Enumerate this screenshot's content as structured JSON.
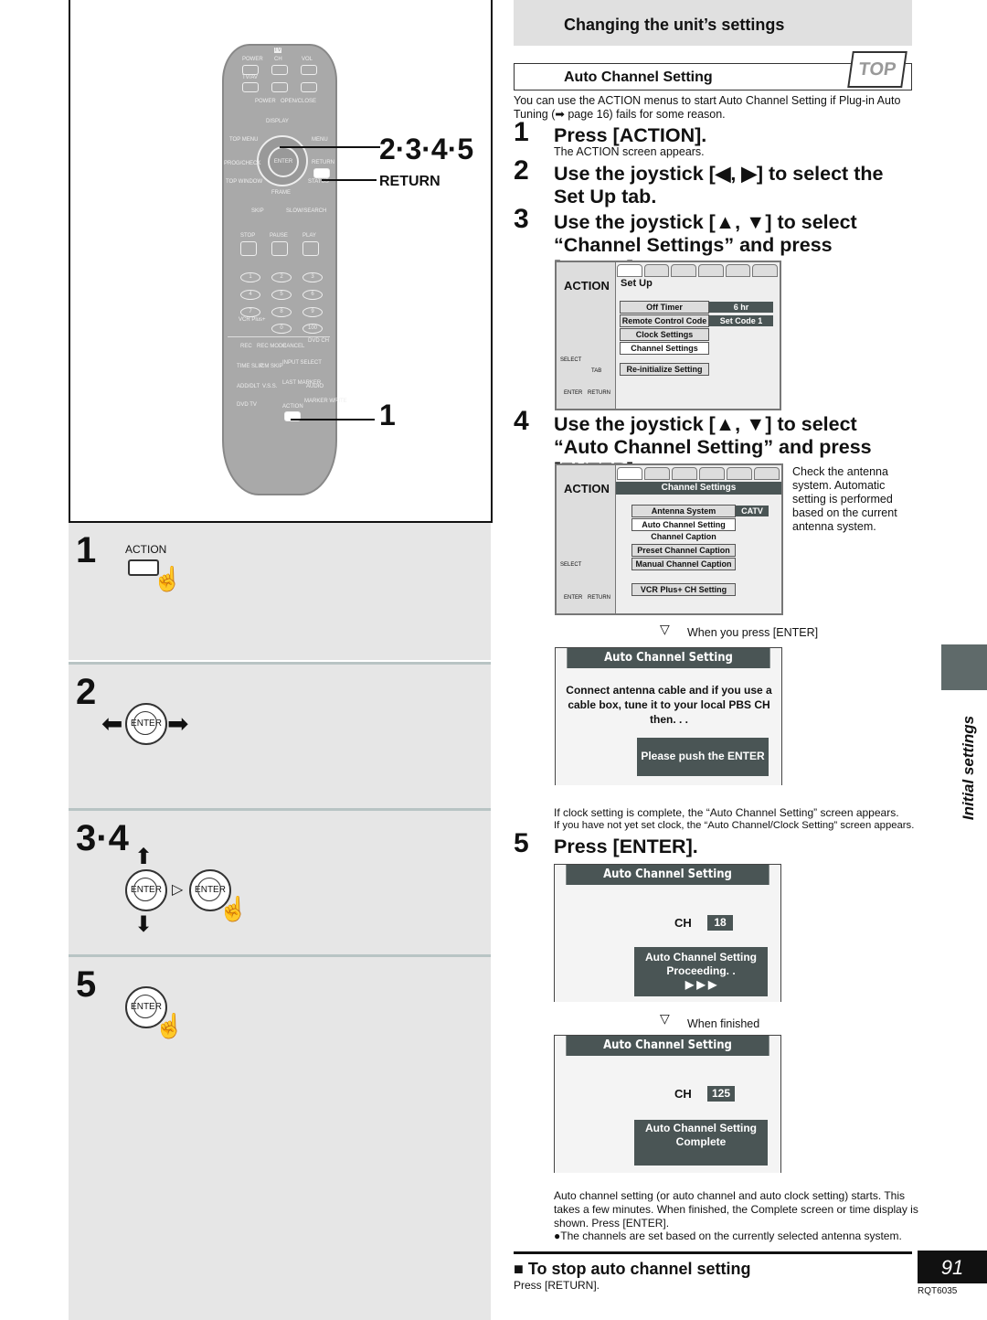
{
  "remote": {
    "labels": {
      "tv": "TV",
      "power": "POWER",
      "ch": "CH",
      "vol": "VOL",
      "tvav": "TV/AV",
      "power2": "POWER",
      "openclose": "OPEN/CLOSE",
      "display": "DISPLAY",
      "topmenu": "TOP MENU",
      "menu": "MENU",
      "enter": "ENTER",
      "return": "RETURN",
      "progcheck": "PROG/CHECK",
      "topwindow": "TOP WINDOW",
      "status": "STATUS",
      "frame": "FRAME",
      "skip": "SKIP",
      "slowsearch": "SLOW/SEARCH",
      "stop": "STOP",
      "pause": "PAUSE",
      "play": "PLAY",
      "vcrplus": "VCR Plus+",
      "rec": "REC",
      "recmode": "REC MODE",
      "cancel": "CANCEL",
      "dvdch": "DVD CH",
      "timeslip": "TIME SLIP",
      "cmskip": "CM SKIP",
      "inputselect": "INPUT SELECT",
      "adddlt": "ADD/DLT",
      "vss": "V.S.S.",
      "lastmarker": "LAST MARKER",
      "audio": "AUDIO",
      "dvdtv": "DVD   TV",
      "action": "ACTION",
      "markerwrite": "MARKER WRITE"
    },
    "numbers": [
      "1",
      "2",
      "3",
      "4",
      "5",
      "6",
      "7",
      "8",
      "9",
      "0",
      "100"
    ],
    "callout_steps": "2·3·4·5",
    "callout_return": "RETURN",
    "callout_1": "1"
  },
  "left_steps": [
    {
      "num": "1",
      "label": "ACTION"
    },
    {
      "num": "2",
      "enter": "ENTER"
    },
    {
      "num": "3·4",
      "enter": "ENTER"
    },
    {
      "num": "5",
      "enter": "ENTER"
    }
  ],
  "header": "Changing the unit’s settings",
  "section": {
    "title": "Auto Channel Setting",
    "logo": "TOP",
    "intro": "You can use the ACTION menus to start Auto Channel Setting if Plug-in Auto Tuning (➡ page 16) fails for some reason."
  },
  "steps": [
    {
      "num": "1",
      "title": "Press [ACTION].",
      "note": "The ACTION screen appears."
    },
    {
      "num": "2",
      "title": "Use the joystick [◀, ▶] to select the Set Up tab."
    },
    {
      "num": "3",
      "title": "Use the joystick [▲, ▼] to select “Channel Settings” and press [ENTER]."
    },
    {
      "num": "4",
      "title": "Use the joystick [▲, ▼] to select “Auto Channel Setting” and press [ENTER].",
      "note": "Check the antenna system. Automatic setting is performed based on the current antenna system."
    },
    {
      "num": "5",
      "title": "Press [ENTER]."
    }
  ],
  "osd1": {
    "action": "ACTION",
    "tab_title": "Set Up",
    "items": [
      "Off Timer",
      "Remote Control Code",
      "Clock Settings",
      "Channel Settings",
      "Re-initialize Setting"
    ],
    "values": [
      "6 hr",
      "Set Code 1"
    ],
    "nav": {
      "select": "SELECT",
      "tab": "TAB",
      "enter": "ENTER",
      "return": "RETURN"
    }
  },
  "osd2": {
    "action": "ACTION",
    "title": "Channel Settings",
    "items": [
      "Antenna System",
      "Auto Channel Setting",
      "Channel Caption",
      "Preset Channel Caption",
      "Manual Channel Caption",
      "VCR Plus+ CH Setting"
    ],
    "value": "CATV",
    "nav": {
      "select": "SELECT",
      "enter": "ENTER",
      "return": "RETURN"
    }
  },
  "when_enter": "When you press [ENTER]",
  "dlg1": {
    "title": "Auto Channel Setting",
    "message": "Connect antenna cable and if you use a cable box, tune it to your local PBS CH then. . .",
    "button": "Please push the ENTER key."
  },
  "clock_note1": "If clock setting is complete, the “Auto Channel Setting” screen appears.",
  "clock_note2": "If you have not yet set clock, the “Auto Channel/Clock Setting” screen appears.",
  "dlg2": {
    "title": "Auto Channel Setting",
    "ch_label": "CH",
    "ch": "18",
    "status": "Auto Channel Setting Proceeding. .",
    "arrows": "▶ ▶ ▶"
  },
  "when_finished": "When finished",
  "dlg3": {
    "title": "Auto Channel Setting",
    "ch_label": "CH",
    "ch": "125",
    "status": "Auto Channel Setting Complete"
  },
  "final_text": "Auto channel setting (or auto channel and auto clock setting) starts. This takes a few minutes. When finished, the Complete screen or time display is shown. Press [ENTER].",
  "final_bullet": "●The channels are set based on the currently selected antenna system.",
  "stop": {
    "title": "■ To stop auto channel setting",
    "text": "Press [RETURN]."
  },
  "side_label": "Initial settings",
  "page_number": "91",
  "doc_code": "RQT6035"
}
